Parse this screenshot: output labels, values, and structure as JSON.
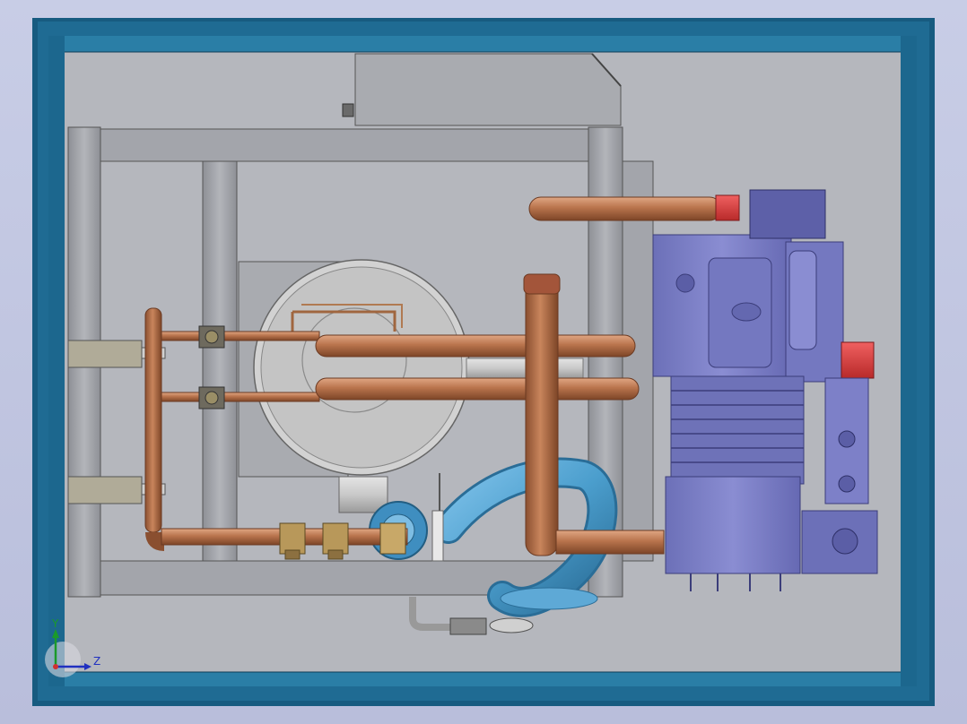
{
  "viewport": {
    "background": "#c4c9e4",
    "view_orientation": "right"
  },
  "colors": {
    "enclosure_frame": "#175b80",
    "enclosure_frame_light": "#2a7ea6",
    "panel_fill": "#b5b7bd",
    "frame_grey": "#a3a5ab",
    "copper_pipe": "#b06f4a",
    "copper_pipe_light": "#d69a73",
    "compressor_body": "#7c7fc6",
    "compressor_dark": "#4b4e96",
    "water_pipe": "#4b9ecd",
    "red_flange": "#d93a3a",
    "brass_valve": "#b8985a"
  },
  "axis_triad": {
    "x_label": "",
    "y_label": "Y",
    "z_label": "Z"
  }
}
